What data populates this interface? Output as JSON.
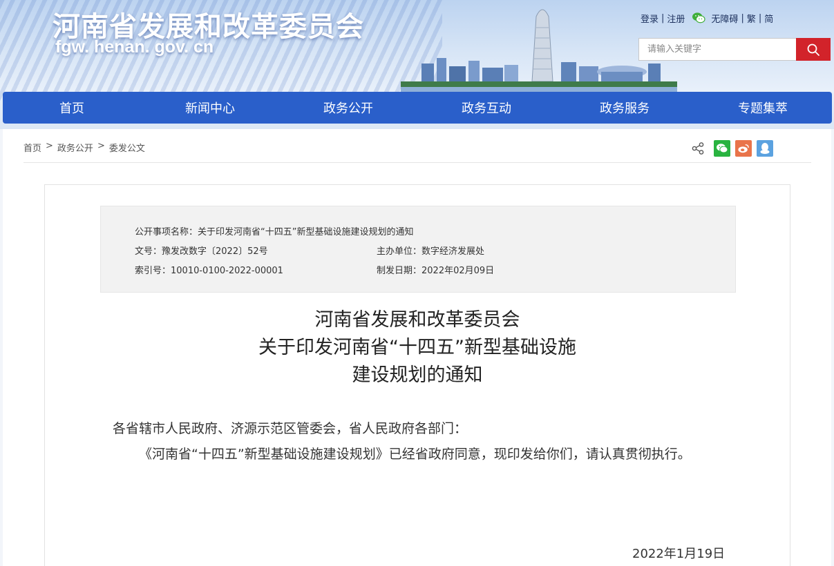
{
  "header": {
    "site_title": "河南省发展和改革委员会",
    "site_domain": "fgw. henan. gov. cn",
    "toplinks": {
      "login": "登录",
      "register": "注册",
      "accessibility": "无障碍",
      "traditional": "繁",
      "simplified": "简",
      "separator": "|"
    },
    "search": {
      "placeholder": "请输入关键字"
    }
  },
  "nav": {
    "items": [
      {
        "label": "首页"
      },
      {
        "label": "新闻中心"
      },
      {
        "label": "政务公开"
      },
      {
        "label": "政务互动"
      },
      {
        "label": "政务服务"
      },
      {
        "label": "专题集萃"
      }
    ]
  },
  "breadcrumb": {
    "items": [
      "首页",
      "政务公开",
      "委发公文"
    ],
    "separator": ">"
  },
  "share": {
    "icons": [
      "share-icon",
      "wechat-icon",
      "weibo-icon",
      "qq-icon"
    ],
    "colors": {
      "wechat": "#29b340",
      "weibo": "#e9744a",
      "qq": "#5ba2e0"
    }
  },
  "meta": {
    "item_name": "公开事项名称：关于印发河南省“十四五”新型基础设施建设规划的通知",
    "doc_number": "文号：豫发改数字〔2022〕52号",
    "department": "主办单位：数字经济发展处",
    "index_number": "索引号：10010-0100-2022-00001",
    "issue_date": "制发日期：2022年02月09日"
  },
  "document": {
    "title_line1": "河南省发展和改革委员会",
    "title_line2": "关于印发河南省“十四五”新型基础设施",
    "title_line3": "建设规划的通知",
    "salutation": "各省辖市人民政府、济源示范区管委会，省人民政府各部门：",
    "body": "《河南省“十四五”新型基础设施建设规划》已经省政府同意，现印发给你们，请认真贯彻执行。",
    "date": "2022年1月19日"
  },
  "colors": {
    "nav_bg": "#2a5fca",
    "search_button": "#d2232a",
    "page_bg": "#f2f5fa"
  }
}
